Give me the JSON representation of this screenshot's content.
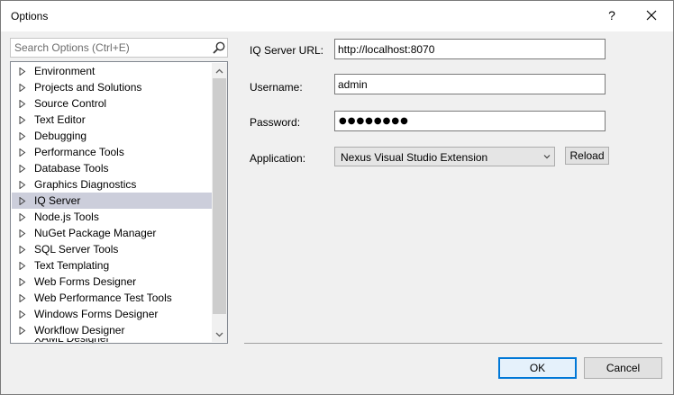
{
  "window": {
    "title": "Options",
    "help_glyph": "?"
  },
  "search": {
    "placeholder": "Search Options (Ctrl+E)"
  },
  "tree": {
    "items": [
      {
        "label": "Environment",
        "selected": false
      },
      {
        "label": "Projects and Solutions",
        "selected": false
      },
      {
        "label": "Source Control",
        "selected": false
      },
      {
        "label": "Text Editor",
        "selected": false
      },
      {
        "label": "Debugging",
        "selected": false
      },
      {
        "label": "Performance Tools",
        "selected": false
      },
      {
        "label": "Database Tools",
        "selected": false
      },
      {
        "label": "Graphics Diagnostics",
        "selected": false
      },
      {
        "label": "IQ Server",
        "selected": true
      },
      {
        "label": "Node.js Tools",
        "selected": false
      },
      {
        "label": "NuGet Package Manager",
        "selected": false
      },
      {
        "label": "SQL Server Tools",
        "selected": false
      },
      {
        "label": "Text Templating",
        "selected": false
      },
      {
        "label": "Web Forms Designer",
        "selected": false
      },
      {
        "label": "Web Performance Test Tools",
        "selected": false
      },
      {
        "label": "Windows Forms Designer",
        "selected": false
      },
      {
        "label": "Workflow Designer",
        "selected": false
      },
      {
        "label": "XAML Designer",
        "selected": false
      }
    ]
  },
  "form": {
    "server_url_label": "IQ Server URL:",
    "server_url_value": "http://localhost:8070",
    "username_label": "Username:",
    "username_value": "admin",
    "password_label": "Password:",
    "password_value": "●●●●●●●●",
    "application_label": "Application:",
    "application_value": "Nexus Visual Studio Extension",
    "reload_label": "Reload"
  },
  "footer": {
    "ok_label": "OK",
    "cancel_label": "Cancel"
  },
  "colors": {
    "selection": "#cccedb",
    "accent": "#0078d7",
    "dialog_bg": "#f0f0f0"
  }
}
